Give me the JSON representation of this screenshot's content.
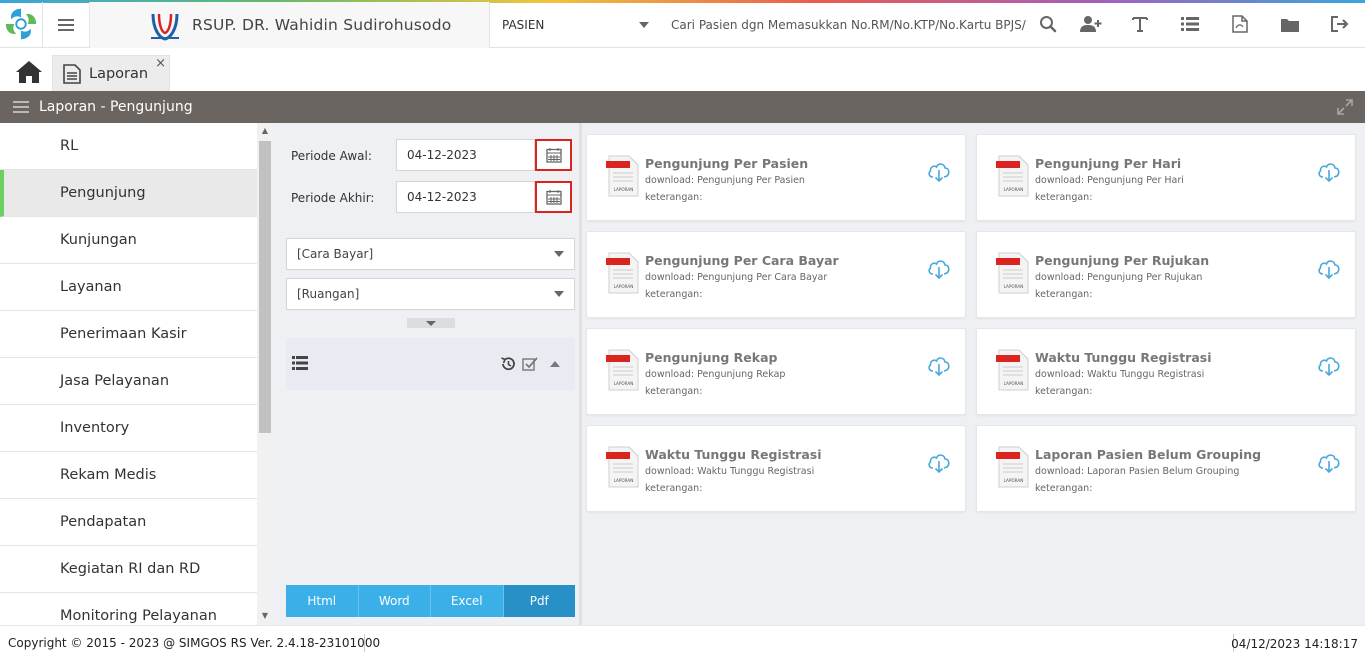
{
  "header": {
    "hospital_name": "RSUP. DR. Wahidin Sudirohusodo",
    "patient_select": "PASIEN",
    "search_placeholder": "Cari Pasien dgn Memasukkan No.RM/No.KTP/No.Kartu BPJS/"
  },
  "tabs": [
    {
      "label": "Laporan",
      "close": "×"
    }
  ],
  "page": {
    "title": "Laporan - Pengunjung"
  },
  "sidebar": {
    "items": [
      {
        "label": "RL"
      },
      {
        "label": "Pengunjung"
      },
      {
        "label": "Kunjungan"
      },
      {
        "label": "Layanan"
      },
      {
        "label": "Penerimaan Kasir"
      },
      {
        "label": "Jasa Pelayanan"
      },
      {
        "label": "Inventory"
      },
      {
        "label": "Rekam Medis"
      },
      {
        "label": "Pendapatan"
      },
      {
        "label": "Kegiatan RI dan RD"
      },
      {
        "label": "Monitoring Pelayanan"
      }
    ],
    "active_item": "Pengunjung"
  },
  "filters": {
    "periode_awal_label": "Periode Awal:",
    "periode_awal_value": "04-12-2023",
    "periode_akhir_label": "Periode Akhir:",
    "periode_akhir_value": "04-12-2023",
    "cara_bayar": "[Cara Bayar]",
    "ruangan": "[Ruangan]"
  },
  "export": {
    "buttons": [
      "Html",
      "Word",
      "Excel",
      "Pdf"
    ],
    "selected": "Pdf"
  },
  "reports": [
    {
      "title": "Pengunjung Per Pasien",
      "download": "download: Pengunjung Per Pasien",
      "note": "keterangan:"
    },
    {
      "title": "Pengunjung Per Hari",
      "download": "download: Pengunjung Per Hari",
      "note": "keterangan:"
    },
    {
      "title": "Pengunjung Per Cara Bayar",
      "download": "download: Pengunjung Per Cara Bayar",
      "note": "keterangan:"
    },
    {
      "title": "Pengunjung Per Rujukan",
      "download": "download: Pengunjung Per Rujukan",
      "note": "keterangan:"
    },
    {
      "title": "Pengunjung Rekap",
      "download": "download: Pengunjung Rekap",
      "note": "keterangan:"
    },
    {
      "title": "Waktu Tunggu Registrasi",
      "download": "download: Waktu Tunggu Registrasi",
      "note": "keterangan:"
    },
    {
      "title": "Waktu Tunggu Registrasi",
      "download": "download: Waktu Tunggu Registrasi",
      "note": "keterangan:"
    },
    {
      "title": "Laporan Pasien Belum Grouping",
      "download": "download: Laporan Pasien Belum Grouping",
      "note": "keterangan:"
    }
  ],
  "report_icon_label": "LAPORAN",
  "footer": {
    "copyright": "Copyright © 2015 - 2023 @ SIMGOS RS Ver. 2.4.18-23101000",
    "datetime": "04/12/2023 14:18:17"
  },
  "colors": {
    "header_bar": "#6b6562",
    "active_accent": "#6ccf61",
    "export_button": "#3bb0e8",
    "export_selected": "#2690c7",
    "calendar_highlight": "#d9251d"
  },
  "icons": {
    "toolbar": [
      "search-icon",
      "add-user-icon",
      "text-icon",
      "list-icon",
      "pdf-file-icon",
      "folder-icon",
      "logout-icon"
    ]
  }
}
